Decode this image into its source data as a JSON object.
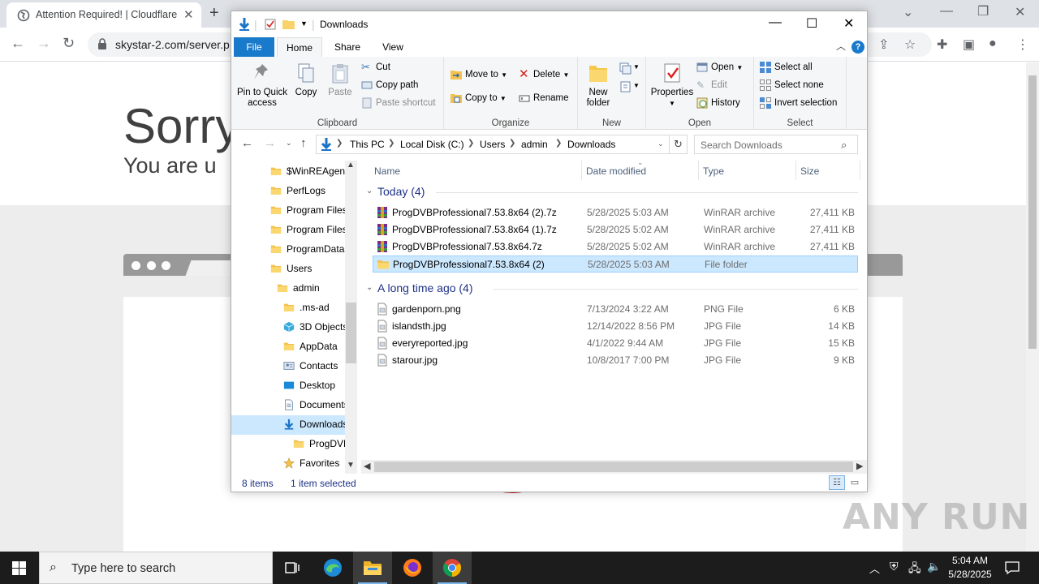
{
  "chrome": {
    "tab_title": "Attention Required! | Cloudflare",
    "url": "skystar-2.com/server.p"
  },
  "cloudflare": {
    "heading": "Sorry",
    "subheading": "You are u"
  },
  "explorer": {
    "title": "Downloads",
    "ribbon_tabs": [
      "File",
      "Home",
      "Share",
      "View"
    ],
    "clipboard": {
      "pin": "Pin to Quick access",
      "copy": "Copy",
      "paste": "Paste",
      "cut": "Cut",
      "copy_path": "Copy path",
      "paste_shortcut": "Paste shortcut",
      "label": "Clipboard"
    },
    "organize": {
      "move_to": "Move to",
      "copy_to": "Copy to",
      "delete": "Delete",
      "rename": "Rename",
      "label": "Organize"
    },
    "new": {
      "new_folder": "New folder",
      "label": "New"
    },
    "open": {
      "properties": "Properties",
      "open": "Open",
      "edit": "Edit",
      "history": "History",
      "label": "Open"
    },
    "select": {
      "select_all": "Select all",
      "select_none": "Select none",
      "invert": "Invert selection",
      "label": "Select"
    },
    "breadcrumb": [
      "This PC",
      "Local Disk (C:)",
      "Users",
      "admin",
      "Downloads"
    ],
    "search_placeholder": "Search Downloads",
    "nav_items": [
      {
        "label": "$WinREAgent",
        "indent": 0,
        "icon": "folder-icon"
      },
      {
        "label": "PerfLogs",
        "indent": 0,
        "icon": "folder-icon"
      },
      {
        "label": "Program Files",
        "indent": 0,
        "icon": "folder-icon"
      },
      {
        "label": "Program Files",
        "indent": 0,
        "icon": "folder-icon"
      },
      {
        "label": "ProgramData",
        "indent": 0,
        "icon": "folder-icon"
      },
      {
        "label": "Users",
        "indent": 0,
        "icon": "folder-icon"
      },
      {
        "label": "admin",
        "indent": 1,
        "icon": "folder-icon"
      },
      {
        "label": ".ms-ad",
        "indent": 2,
        "icon": "folder-icon"
      },
      {
        "label": "3D Objects",
        "indent": 2,
        "icon": "cube-icon"
      },
      {
        "label": "AppData",
        "indent": 2,
        "icon": "folder-icon"
      },
      {
        "label": "Contacts",
        "indent": 2,
        "icon": "contacts-icon"
      },
      {
        "label": "Desktop",
        "indent": 2,
        "icon": "desktop-icon"
      },
      {
        "label": "Documents",
        "indent": 2,
        "icon": "document-icon"
      },
      {
        "label": "Downloads",
        "indent": 2,
        "icon": "download-icon",
        "selected": true
      },
      {
        "label": "ProgDVB",
        "indent": 3,
        "icon": "folder-icon"
      },
      {
        "label": "Favorites",
        "indent": 2,
        "icon": "star-icon"
      }
    ],
    "columns": [
      "Name",
      "Date modified",
      "Type",
      "Size"
    ],
    "groups": [
      {
        "label": "Today (4)",
        "files": [
          {
            "name": "ProgDVBProfessional7.53.8x64 (2).7z",
            "date": "5/28/2025 5:03 AM",
            "type": "WinRAR archive",
            "size": "27,411 KB",
            "icon": "winrar-icon"
          },
          {
            "name": "ProgDVBProfessional7.53.8x64 (1).7z",
            "date": "5/28/2025 5:02 AM",
            "type": "WinRAR archive",
            "size": "27,411 KB",
            "icon": "winrar-icon"
          },
          {
            "name": "ProgDVBProfessional7.53.8x64.7z",
            "date": "5/28/2025 5:02 AM",
            "type": "WinRAR archive",
            "size": "27,411 KB",
            "icon": "winrar-icon"
          },
          {
            "name": "ProgDVBProfessional7.53.8x64 (2)",
            "date": "5/28/2025 5:03 AM",
            "type": "File folder",
            "size": "",
            "icon": "folder-icon",
            "selected": true
          }
        ]
      },
      {
        "label": "A long time ago (4)",
        "files": [
          {
            "name": "gardenporn.png",
            "date": "7/13/2024 3:22 AM",
            "type": "PNG File",
            "size": "6 KB",
            "icon": "image-file-icon"
          },
          {
            "name": "islandsth.jpg",
            "date": "12/14/2022 8:56 PM",
            "type": "JPG File",
            "size": "14 KB",
            "icon": "image-file-icon"
          },
          {
            "name": "everyreported.jpg",
            "date": "4/1/2022 9:44 AM",
            "type": "JPG File",
            "size": "15 KB",
            "icon": "image-file-icon"
          },
          {
            "name": "starour.jpg",
            "date": "10/8/2017 7:00 PM",
            "type": "JPG File",
            "size": "9 KB",
            "icon": "image-file-icon"
          }
        ]
      }
    ],
    "status_items": "8 items",
    "status_selected": "1 item selected"
  },
  "taskbar": {
    "search_placeholder": "Type here to search",
    "time": "5:04 AM",
    "date": "5/28/2025"
  },
  "watermark": "ANY RUN",
  "colors": {
    "accent": "#1979ca",
    "selection": "#cce8ff",
    "cloudflare_red": "#bd2426",
    "group_header": "#1e3287"
  }
}
